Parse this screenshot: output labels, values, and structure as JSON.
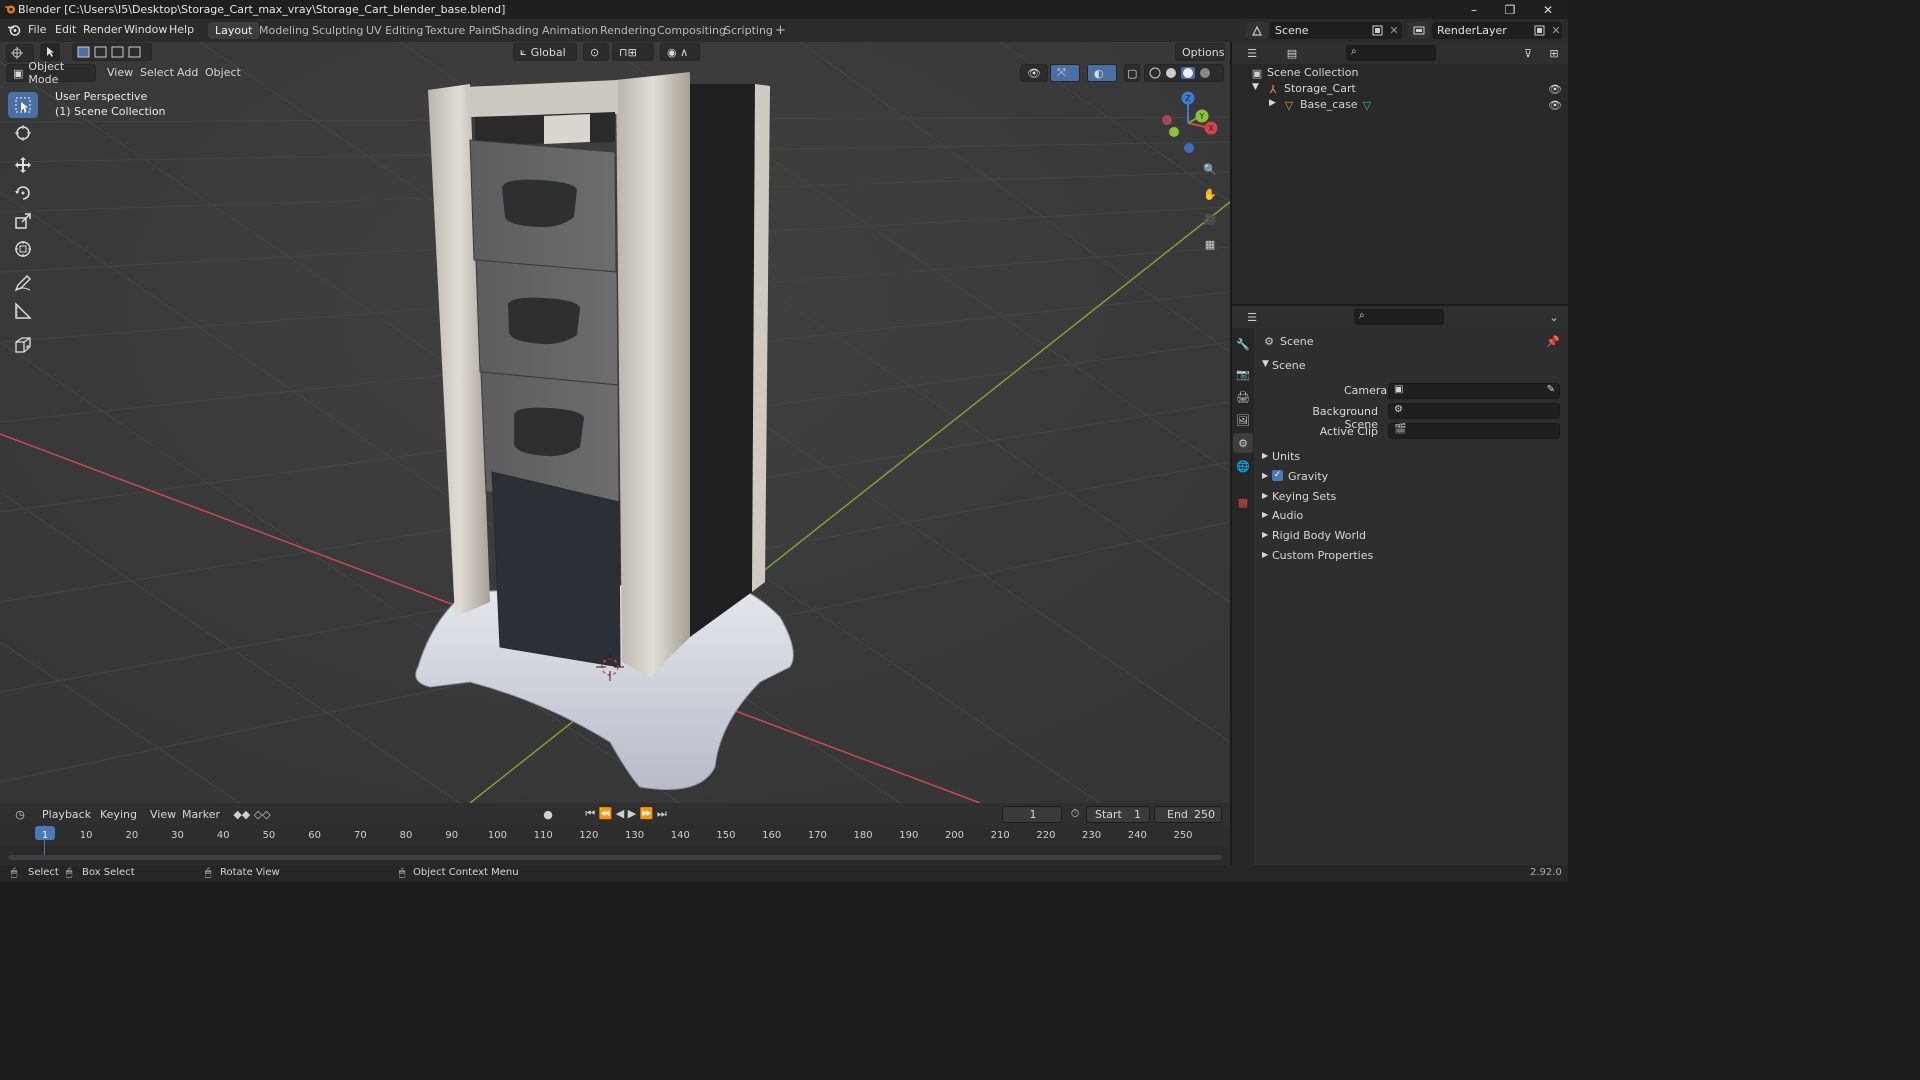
{
  "window": {
    "title": "Blender [C:\\Users\\I5\\Desktop\\Storage_Cart_max_vray\\Storage_Cart_blender_base.blend]",
    "controls": [
      "–",
      "❐",
      "✕"
    ]
  },
  "menubar": {
    "items": [
      "File",
      "Edit",
      "Render",
      "Window",
      "Help"
    ],
    "workspaces": [
      "Layout",
      "Modeling",
      "Sculpting",
      "UV Editing",
      "Texture Paint",
      "Shading",
      "Animation",
      "Rendering",
      "Compositing",
      "Scripting"
    ],
    "active_workspace": "Layout",
    "add_tab": "+",
    "scene_label": "Scene",
    "renderlayer_label": "RenderLayer"
  },
  "viewport": {
    "transform_orientation": "Global",
    "options_label": "Options",
    "mode": "Object Mode",
    "menus": [
      "View",
      "Select",
      "Add",
      "Object"
    ],
    "overlay_line1": "User Perspective",
    "overlay_line2": "(1) Scene Collection",
    "gizmo_axes": {
      "x": "X",
      "y": "Y",
      "z": "Z"
    },
    "colors": {
      "bg": "#3a3a3a",
      "x_axis": "#c84a52",
      "y_axis": "#7aa434",
      "z_axis": "#3d7bd6"
    }
  },
  "outliner": {
    "root": "Scene Collection",
    "items": [
      {
        "name": "Storage_Cart",
        "icon": "empty-axes-icon"
      },
      {
        "name": "Base_case",
        "icon": "mesh-icon"
      }
    ]
  },
  "properties": {
    "header": "Scene",
    "panel_title": "Scene",
    "fields": [
      {
        "label": "Camera",
        "icon": "camera-object-icon"
      },
      {
        "label": "Background Scene",
        "icon": "scene-icon"
      },
      {
        "label": "Active Clip",
        "icon": "clip-icon"
      }
    ],
    "subpanels": [
      {
        "label": "Units",
        "checkbox": false
      },
      {
        "label": "Gravity",
        "checkbox": true
      },
      {
        "label": "Keying Sets",
        "checkbox": false
      },
      {
        "label": "Audio",
        "checkbox": false
      },
      {
        "label": "Rigid Body World",
        "checkbox": false
      },
      {
        "label": "Custom Properties",
        "checkbox": false
      }
    ]
  },
  "timeline": {
    "menus": [
      "Playback",
      "Keying",
      "View",
      "Marker"
    ],
    "current_frame": "1",
    "start_label": "Start",
    "start_value": "1",
    "end_label": "End",
    "end_value": "250",
    "ticks": [
      "1",
      "10",
      "20",
      "30",
      "40",
      "50",
      "60",
      "70",
      "80",
      "90",
      "100",
      "110",
      "120",
      "130",
      "140",
      "150",
      "160",
      "170",
      "180",
      "190",
      "200",
      "210",
      "220",
      "230",
      "240",
      "250"
    ]
  },
  "statusbar": {
    "select": "Select",
    "box_select": "Box Select",
    "rotate_view": "Rotate View",
    "context_menu": "Object Context Menu",
    "version": "2.92.0"
  }
}
